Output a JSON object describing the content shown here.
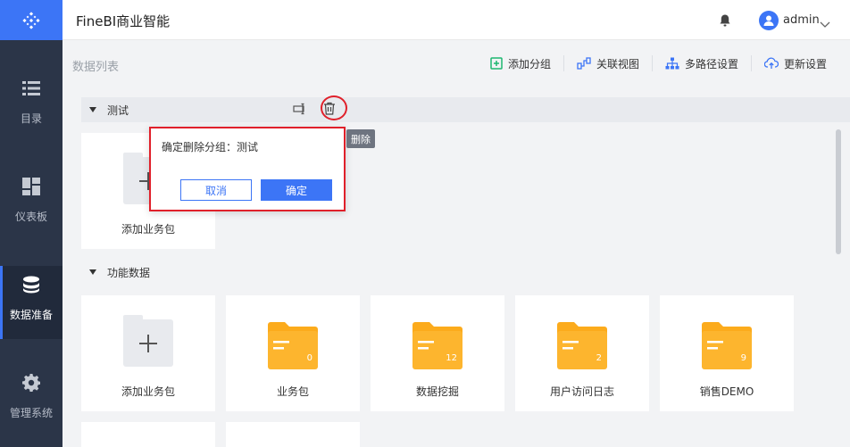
{
  "app": {
    "title": "FineBI商业智能"
  },
  "sidebar": {
    "items": [
      {
        "label": "目录",
        "icon": "list-icon"
      },
      {
        "label": "仪表板",
        "icon": "dashboard-icon"
      },
      {
        "label": "数据准备",
        "icon": "database-icon",
        "active": true
      },
      {
        "label": "管理系统",
        "icon": "gear-icon"
      }
    ]
  },
  "header": {
    "user": "admin"
  },
  "page": {
    "title": "数据列表"
  },
  "toolbar": {
    "add_group": "添加分组",
    "relation_view": "关联视图",
    "multipath": "多路径设置",
    "update_settings": "更新设置"
  },
  "groups": [
    {
      "name": "测试",
      "cards": [
        {
          "label": "添加业务包",
          "type": "add"
        }
      ]
    },
    {
      "name": "功能数据",
      "cards": [
        {
          "label": "添加业务包",
          "type": "add"
        },
        {
          "label": "业务包",
          "type": "folder",
          "count": "0"
        },
        {
          "label": "数据挖掘",
          "type": "folder",
          "count": "12"
        },
        {
          "label": "用户访问日志",
          "type": "folder",
          "count": "2"
        },
        {
          "label": "销售DEMO",
          "type": "folder",
          "count": "9"
        }
      ]
    }
  ],
  "popover": {
    "message": "确定删除分组：测试",
    "cancel": "取消",
    "confirm": "确定"
  },
  "tooltip": {
    "text": "删除"
  },
  "colors": {
    "accent": "#3c75f6",
    "sidebar": "#2b3548",
    "folder": "#fcab1c",
    "highlight": "#e0202a"
  }
}
